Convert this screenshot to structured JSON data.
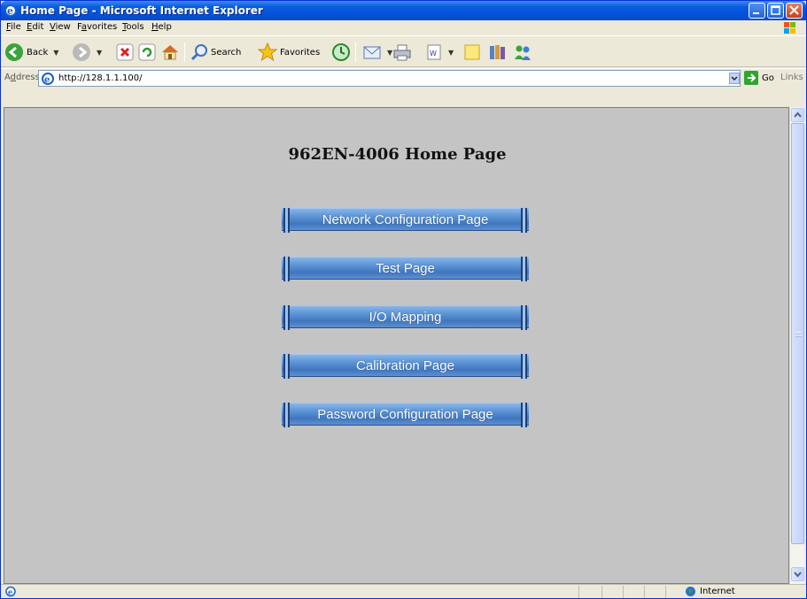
{
  "window": {
    "title": "Home Page - Microsoft Internet Explorer"
  },
  "menu": {
    "items": [
      {
        "accel": "F",
        "rest": "ile"
      },
      {
        "accel": "E",
        "rest": "dit"
      },
      {
        "accel": "V",
        "rest": "iew"
      },
      {
        "pre": "F",
        "accel": "a",
        "rest": "vorites"
      },
      {
        "accel": "T",
        "rest": "ools"
      },
      {
        "accel": "H",
        "rest": "elp"
      }
    ]
  },
  "toolbar": {
    "back_label": "Back",
    "search_label": "Search",
    "favorites_label": "Favorites"
  },
  "address": {
    "label_pre": "A",
    "label_accel": "d",
    "label_rest": "dress",
    "url": "http://128.1.1.100/",
    "go_label": "Go",
    "links_label": "Links"
  },
  "page": {
    "heading": "962EN-4006 Home Page",
    "buttons": [
      "Network Configuration Page",
      "Test Page",
      "I/O Mapping",
      "Calibration Page",
      "Password Configuration Page"
    ]
  },
  "status": {
    "zone": "Internet"
  },
  "colors": {
    "titlebar": "#0a5ce0",
    "content_bg": "#c4c4c4",
    "button_blue": "#5d95d6"
  }
}
